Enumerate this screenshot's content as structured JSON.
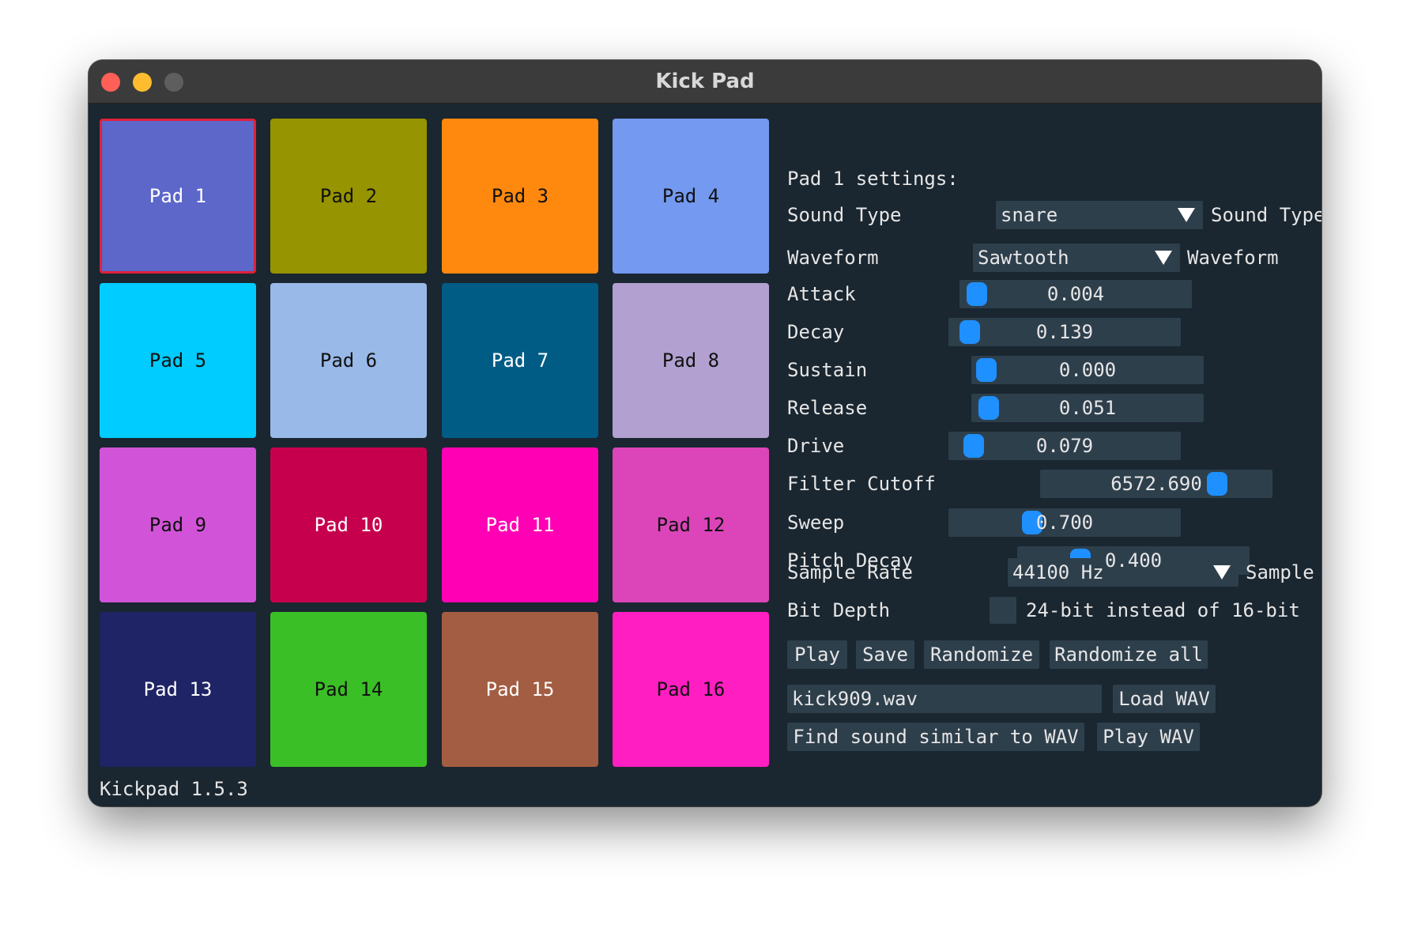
{
  "window": {
    "title": "Kick Pad"
  },
  "pads": [
    {
      "label": "Pad 1",
      "color": "#5c67c9",
      "text_color": "#ffffff",
      "selected": true
    },
    {
      "label": "Pad 2",
      "color": "#969400",
      "text_color": "#111111"
    },
    {
      "label": "Pad 3",
      "color": "#ff880f",
      "text_color": "#111111"
    },
    {
      "label": "Pad 4",
      "color": "#7399f0",
      "text_color": "#111111"
    },
    {
      "label": "Pad 5",
      "color": "#00ccff",
      "text_color": "#111111"
    },
    {
      "label": "Pad 6",
      "color": "#99b9e8",
      "text_color": "#111111"
    },
    {
      "label": "Pad 7",
      "color": "#005c85",
      "text_color": "#ffffff"
    },
    {
      "label": "Pad 8",
      "color": "#b1a0d0",
      "text_color": "#111111"
    },
    {
      "label": "Pad 9",
      "color": "#d154d8",
      "text_color": "#111111"
    },
    {
      "label": "Pad 10",
      "color": "#c7004e",
      "text_color": "#ffffff"
    },
    {
      "label": "Pad 11",
      "color": "#ff00b4",
      "text_color": "#ffffff"
    },
    {
      "label": "Pad 12",
      "color": "#db45b9",
      "text_color": "#111111"
    },
    {
      "label": "Pad 13",
      "color": "#1f2466",
      "text_color": "#ffffff"
    },
    {
      "label": "Pad 14",
      "color": "#3bbf26",
      "text_color": "#111111"
    },
    {
      "label": "Pad 15",
      "color": "#a35d42",
      "text_color": "#ffffff"
    },
    {
      "label": "Pad 16",
      "color": "#ff1ec1",
      "text_color": "#111111"
    }
  ],
  "settings": {
    "heading": "Pad 1 settings:",
    "sound_type": {
      "label": "Sound Type",
      "value": "snare",
      "suffix": "Sound Type"
    },
    "waveform": {
      "label": "Waveform",
      "value": "Sawtooth",
      "suffix": "Waveform"
    },
    "sliders": [
      {
        "key": "attack",
        "label": "Attack",
        "value": "0.004",
        "fraction": 0.01
      },
      {
        "key": "decay",
        "label": "Decay",
        "value": "0.139",
        "fraction": 0.03
      },
      {
        "key": "sustain",
        "label": "Sustain",
        "value": "0.000",
        "fraction": 0.0
      },
      {
        "key": "release",
        "label": "Release",
        "value": "0.051",
        "fraction": 0.01
      },
      {
        "key": "drive",
        "label": "Drive",
        "value": "0.079",
        "fraction": 0.05
      },
      {
        "key": "filter_cutoff",
        "label": "Filter Cutoff",
        "value": "6572.690",
        "fraction": 0.8
      },
      {
        "key": "sweep",
        "label": "Sweep",
        "value": "0.700",
        "fraction": 0.34
      },
      {
        "key": "pitch_decay",
        "label": "Pitch Decay",
        "value": "0.400",
        "fraction": 0.24
      }
    ],
    "sample_rate": {
      "label": "Sample Rate",
      "value": "44100 Hz",
      "suffix": "Sample Rate"
    },
    "bit_depth": {
      "label": "Bit Depth",
      "checkbox_label": "24-bit instead of 16-bit",
      "checked": false
    },
    "buttons": {
      "play": "Play",
      "save": "Save",
      "randomize": "Randomize",
      "randomize_all": "Randomize all"
    },
    "wav_file": {
      "value": "kick909.wav",
      "load": "Load WAV"
    },
    "find_similar": "Find sound similar to WAV",
    "play_wav": "Play WAV"
  },
  "footer": {
    "version": "Kickpad 1.5.3"
  },
  "colors": {
    "background": "#1a2630",
    "widget": "#2e3f4c",
    "accent": "#1e90ff",
    "selection": "#e0203a"
  }
}
